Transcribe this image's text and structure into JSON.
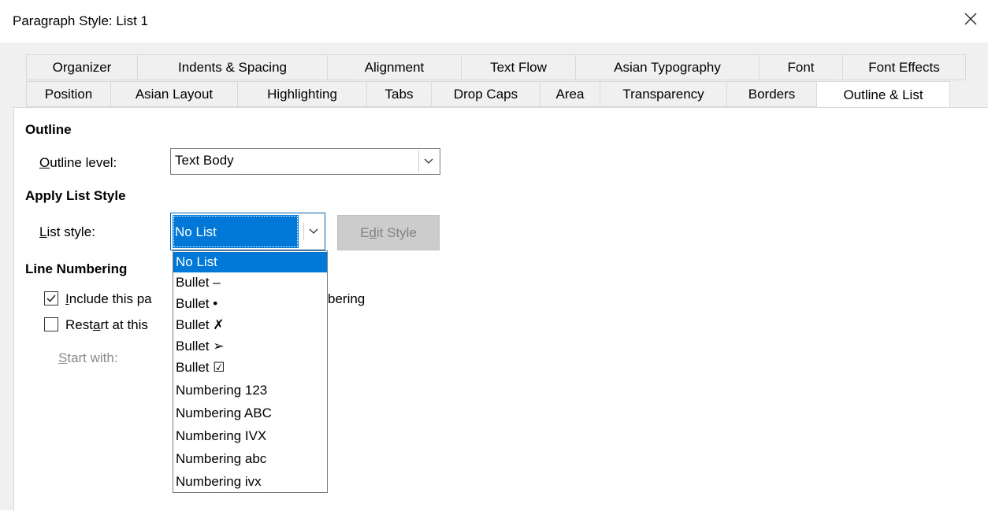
{
  "window": {
    "title": "Paragraph Style: List 1"
  },
  "tabs": {
    "row1": [
      "Organizer",
      "Indents & Spacing",
      "Alignment",
      "Text Flow",
      "Asian Typography",
      "Font",
      "Font Effects"
    ],
    "row2": [
      "Position",
      "Asian Layout",
      "Highlighting",
      "Tabs",
      "Drop Caps",
      "Area",
      "Transparency",
      "Borders",
      "Outline & List"
    ],
    "selected": "Outline & List"
  },
  "outline": {
    "heading": "Outline",
    "level_label_pre": "",
    "level_label_accel": "O",
    "level_label_post": "utline level:",
    "level_value": "Text Body"
  },
  "list_style": {
    "heading": "Apply List Style",
    "label_accel": "L",
    "label_post": "ist style:",
    "value": "No List",
    "edit_pre": "E",
    "edit_accel": "d",
    "edit_post": "it Style",
    "options": [
      "No List",
      "Bullet –",
      "Bullet •",
      "Bullet ✗",
      "Bullet ➢",
      "Bullet ☑",
      "Numbering 123",
      "Numbering ABC",
      "Numbering IVX",
      "Numbering abc",
      "Numbering ivx"
    ]
  },
  "line_numbering": {
    "heading": "Line Numbering",
    "include_accel": "I",
    "include_visible": "nclude this pa",
    "include_tail": "bering",
    "include_checked": true,
    "restart_pre": "Rest",
    "restart_accel": "a",
    "restart_post": "rt at this",
    "restart_checked": false,
    "start_accel": "S",
    "start_post": "tart with:"
  },
  "colors": {
    "accent": "#0078d7",
    "disabled_button": "#cccccc"
  },
  "icons": {
    "close": "close-icon",
    "dropdown": "chevron-down-icon",
    "check": "check-icon"
  }
}
